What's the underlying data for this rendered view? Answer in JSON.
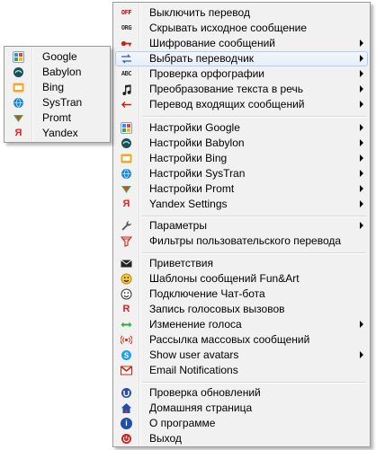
{
  "main_menu": {
    "items": [
      {
        "label": "Выключить перевод",
        "icon": "off-icon"
      },
      {
        "label": "Скрывать исходное сообщение",
        "icon": "orig-icon"
      },
      {
        "label": "Шифрование сообщений",
        "icon": "key-icon"
      },
      {
        "label": "Выбрать переводчик",
        "icon": "swap-arrows-icon"
      },
      {
        "label": "Проверка орфографии",
        "icon": "spellcheck-icon"
      },
      {
        "label": "Преобразование текста в речь",
        "icon": "music-note-icon"
      },
      {
        "label": "Перевод входящих сообщений",
        "icon": "incoming-arrow-icon"
      },
      {
        "label": "Настройки Google",
        "icon": "google-icon"
      },
      {
        "label": "Настройки Babylon",
        "icon": "babylon-icon"
      },
      {
        "label": "Настройки Bing",
        "icon": "bing-icon"
      },
      {
        "label": "Настройки SysTran",
        "icon": "systran-icon"
      },
      {
        "label": "Настройки Promt",
        "icon": "promt-icon"
      },
      {
        "label": "Yandex Settings",
        "icon": "yandex-icon"
      },
      {
        "label": "Параметры",
        "icon": "wrench-icon"
      },
      {
        "label": "Фильтры пользовательского перевода",
        "icon": "filter-icon"
      },
      {
        "label": "Приветствия",
        "icon": "envelope-icon"
      },
      {
        "label": "Шаблоны сообщений Fun&Art",
        "icon": "smiley-icon"
      },
      {
        "label": "Подключение Чат-бота",
        "icon": "bot-face-icon"
      },
      {
        "label": "Запись голосовых вызовов",
        "icon": "record-r-icon"
      },
      {
        "label": "Изменение голоса",
        "icon": "voice-change-icon"
      },
      {
        "label": "Рассылка массовых сообщений",
        "icon": "broadcast-icon"
      },
      {
        "label": "Show user avatars",
        "icon": "skype-icon"
      },
      {
        "label": "Email Notifications",
        "icon": "gmail-icon"
      },
      {
        "label": "Проверка обновлений",
        "icon": "update-icon"
      },
      {
        "label": "Домашняя страница",
        "icon": "home-icon"
      },
      {
        "label": "О программе",
        "icon": "info-icon"
      },
      {
        "label": "Выход",
        "icon": "power-icon"
      }
    ]
  },
  "sub_menu": {
    "items": [
      {
        "label": "Google",
        "icon": "google-icon"
      },
      {
        "label": "Babylon",
        "icon": "babylon-icon"
      },
      {
        "label": "Bing",
        "icon": "bing-icon"
      },
      {
        "label": "SysTran",
        "icon": "systran-icon"
      },
      {
        "label": "Promt",
        "icon": "promt-icon"
      },
      {
        "label": "Yandex",
        "icon": "yandex-icon"
      }
    ]
  },
  "icon_text": {
    "off": "OFF",
    "orig": "ORG",
    "abc": "ABC",
    "yandex": "Я",
    "r": "R",
    "info": "i"
  },
  "colors": {
    "highlight_border": "#aecff7",
    "menu_bg": "#f1f1f1",
    "red_icons": "#d32020"
  }
}
